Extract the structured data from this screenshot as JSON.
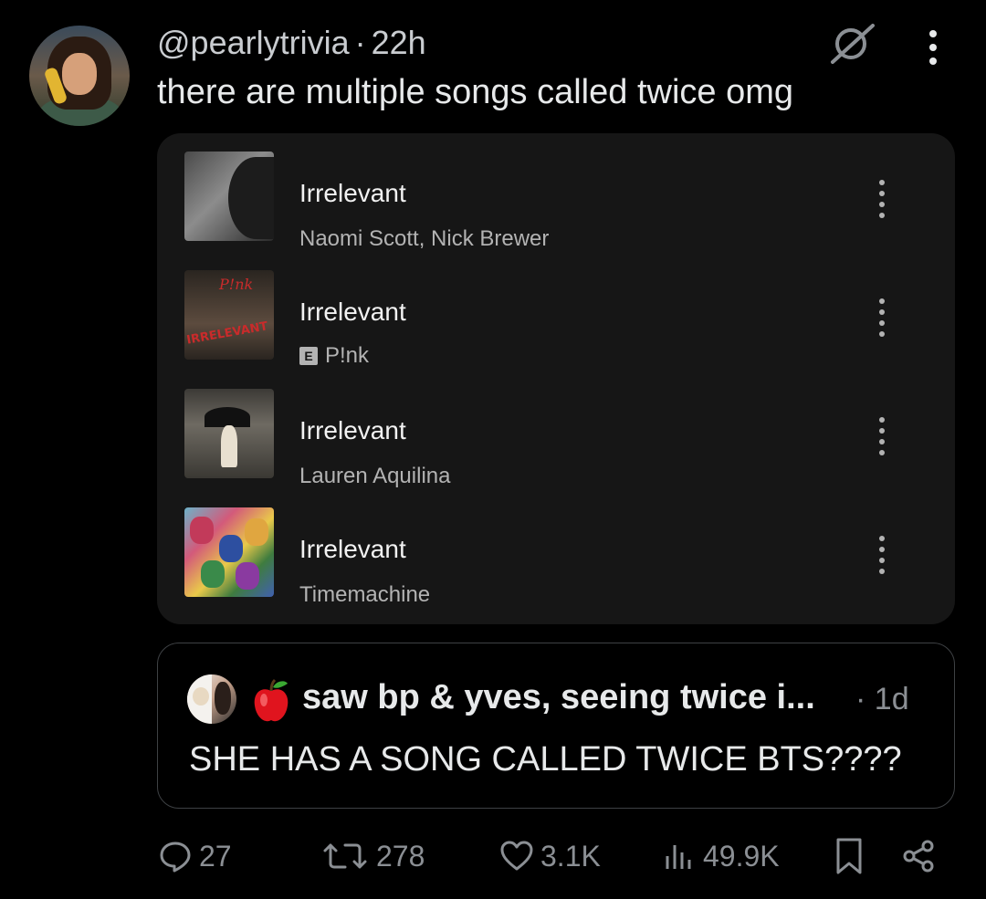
{
  "post": {
    "handle": "@pearlytrivia",
    "separator": "·",
    "time": "22h",
    "text": "there are multiple songs called twice omg"
  },
  "tracks": [
    {
      "title": "Irrelevant",
      "artist": "Naomi Scott, Nick Brewer",
      "explicit": false
    },
    {
      "title": "Irrelevant",
      "artist": "P!nk",
      "explicit": true,
      "explicit_label": "E"
    },
    {
      "title": "Irrelevant",
      "artist": "Lauren Aquilina",
      "explicit": false
    },
    {
      "title": "Irrelevant",
      "artist": "Timemachine",
      "explicit": false
    }
  ],
  "art_text": {
    "pink_title": "IRRELEVANT",
    "pink_logo": "P!nk"
  },
  "quote": {
    "name": "saw bp & yves, seeing twice i...",
    "separator": "·",
    "time": "1d",
    "text": "SHE HAS A SONG CALLED TWICE BTS????"
  },
  "actions": {
    "replies": "27",
    "reposts": "278",
    "likes": "3.1K",
    "views": "49.9K"
  },
  "icons": {
    "grok": "grok-icon",
    "more": "more-vertical-icon",
    "reply": "reply-icon",
    "repost": "repost-icon",
    "like": "heart-icon",
    "views": "views-chart-icon",
    "bookmark": "bookmark-icon",
    "share": "share-icon",
    "apple": "apple-emoji"
  },
  "colors": {
    "background": "#000000",
    "card": "#161616",
    "text": "#e7e9ea",
    "muted": "#8b8f94",
    "track_sub": "#b3b3b3",
    "quote_border": "#3e4144"
  }
}
